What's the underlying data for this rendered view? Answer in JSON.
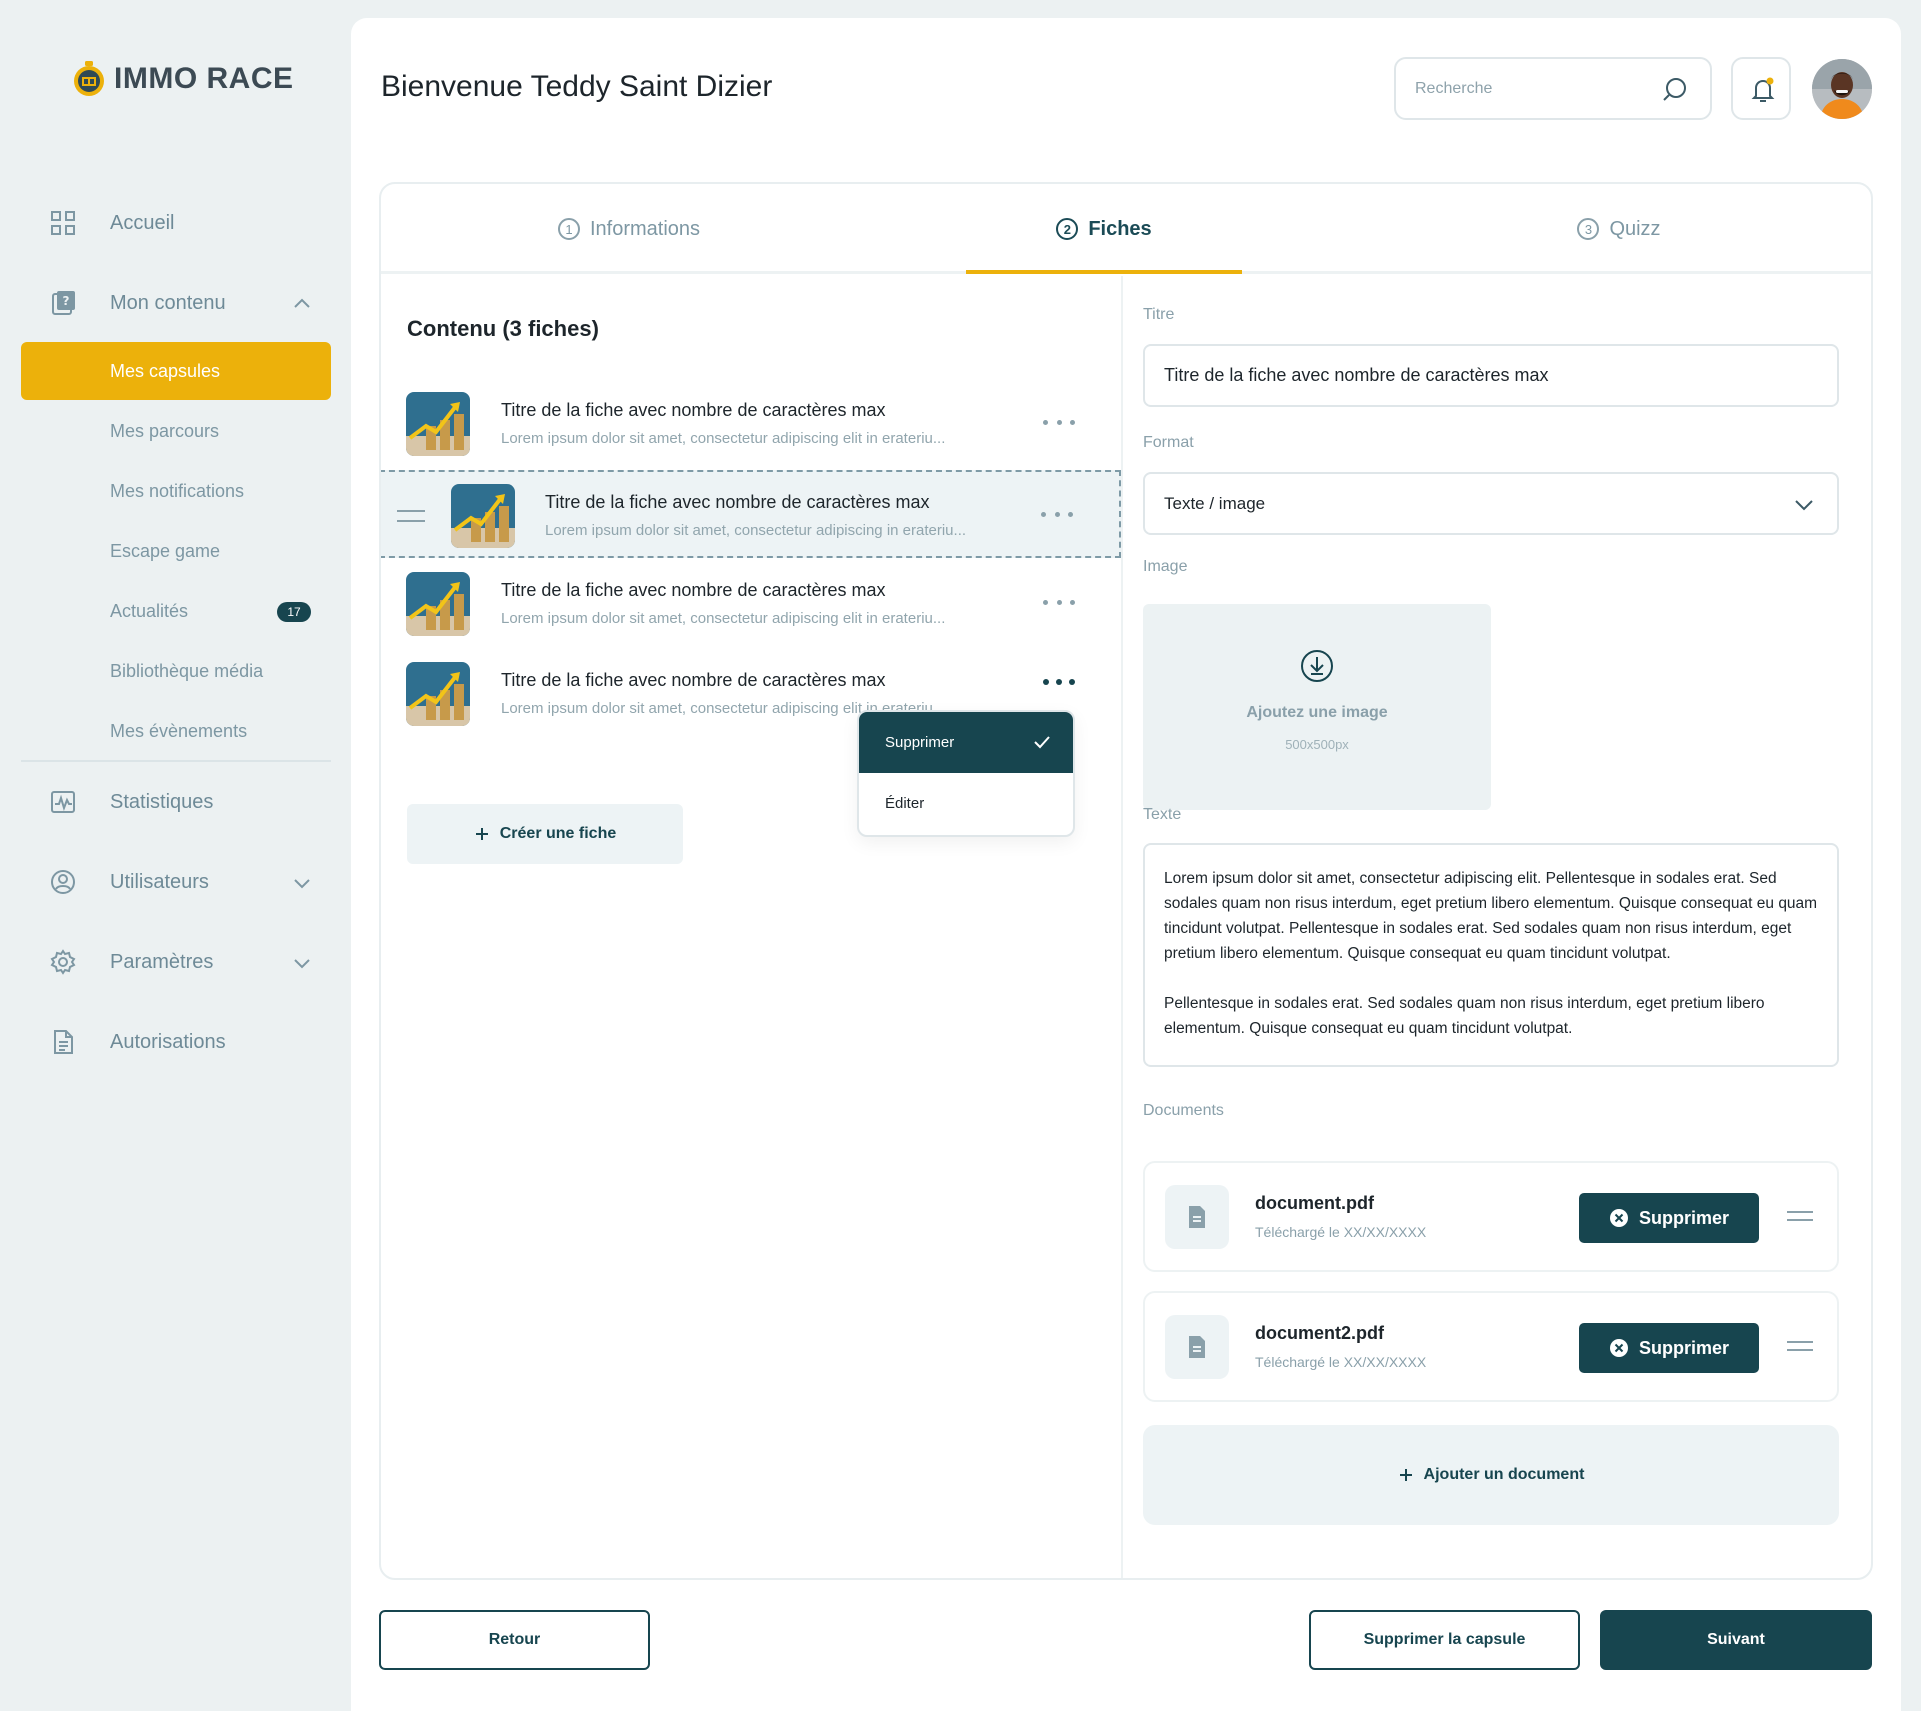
{
  "brand": {
    "name": "IMMO RACE"
  },
  "sidebar": {
    "items": [
      {
        "label": "Accueil",
        "icon": "grid-icon"
      },
      {
        "label": "Mon contenu",
        "icon": "content-icon"
      },
      {
        "label": "Statistiques",
        "icon": "stats-icon"
      },
      {
        "label": "Utilisateurs",
        "icon": "user-icon"
      },
      {
        "label": "Paramètres",
        "icon": "gear-icon"
      },
      {
        "label": "Autorisations",
        "icon": "document-icon"
      }
    ],
    "subitems": [
      {
        "label": "Mes capsules",
        "active": true
      },
      {
        "label": "Mes parcours"
      },
      {
        "label": "Mes notifications"
      },
      {
        "label": "Escape game"
      },
      {
        "label": "Actualités",
        "badge": "17"
      },
      {
        "label": "Bibliothèque média"
      },
      {
        "label": "Mes évènements"
      }
    ]
  },
  "header": {
    "welcome": "Bienvenue Teddy Saint Dizier",
    "search_placeholder": "Recherche"
  },
  "tabs": [
    {
      "num": "1",
      "label": "Informations"
    },
    {
      "num": "2",
      "label": "Fiches",
      "active": true
    },
    {
      "num": "3",
      "label": "Quizz"
    }
  ],
  "content": {
    "title": "Contenu (3 fiches)",
    "fiches": [
      {
        "title": "Titre de la fiche avec nombre de caractères max",
        "subtitle": "Lorem ipsum dolor sit amet, consectetur adipiscing elit in erateriu..."
      },
      {
        "title": "Titre de la fiche avec nombre de caractères max",
        "subtitle": "Lorem ipsum dolor sit amet, consectetur adipiscing in erateriu..."
      },
      {
        "title": "Titre de la fiche avec nombre de caractères max",
        "subtitle": "Lorem ipsum dolor sit amet, consectetur adipiscing elit in erateriu..."
      },
      {
        "title": "Titre de la fiche avec nombre de caractères max",
        "subtitle": "Lorem ipsum dolor sit amet, consectetur adipiscing elit in erateriu..."
      }
    ],
    "menu": {
      "delete": "Supprimer",
      "edit": "Éditer"
    },
    "create_label": "Créer une fiche"
  },
  "form": {
    "title_label": "Titre",
    "title_value": "Titre de la fiche avec nombre de caractères max",
    "format_label": "Format",
    "format_value": "Texte / image",
    "image_label": "Image",
    "image_add": "Ajoutez une image",
    "image_size": "500x500px",
    "text_label": "Texte",
    "text_p1": "Lorem ipsum dolor sit amet, consectetur adipiscing elit. Pellentesque in sodales erat. Sed sodales quam non risus interdum, eget pretium libero elementum. Quisque consequat eu quam tincidunt volutpat. Pellentesque in sodales erat. Sed sodales quam non risus interdum, eget pretium libero elementum. Quisque consequat eu quam tincidunt volutpat.",
    "text_p2": "Pellentesque in sodales erat. Sed sodales quam non risus interdum, eget pretium libero elementum. Quisque consequat eu quam tincidunt volutpat.",
    "documents_label": "Documents",
    "documents": [
      {
        "name": "document.pdf",
        "date": "Téléchargé le XX/XX/XXXX",
        "delete": "Supprimer"
      },
      {
        "name": "document2.pdf",
        "date": "Téléchargé le XX/XX/XXXX",
        "delete": "Supprimer"
      }
    ],
    "add_document": "Ajouter un document"
  },
  "footer": {
    "back": "Retour",
    "delete_capsule": "Supprimer la capsule",
    "next": "Suivant"
  },
  "colors": {
    "accent": "#ECB10B",
    "primary": "#17454F",
    "muted": "#7D97A3"
  }
}
